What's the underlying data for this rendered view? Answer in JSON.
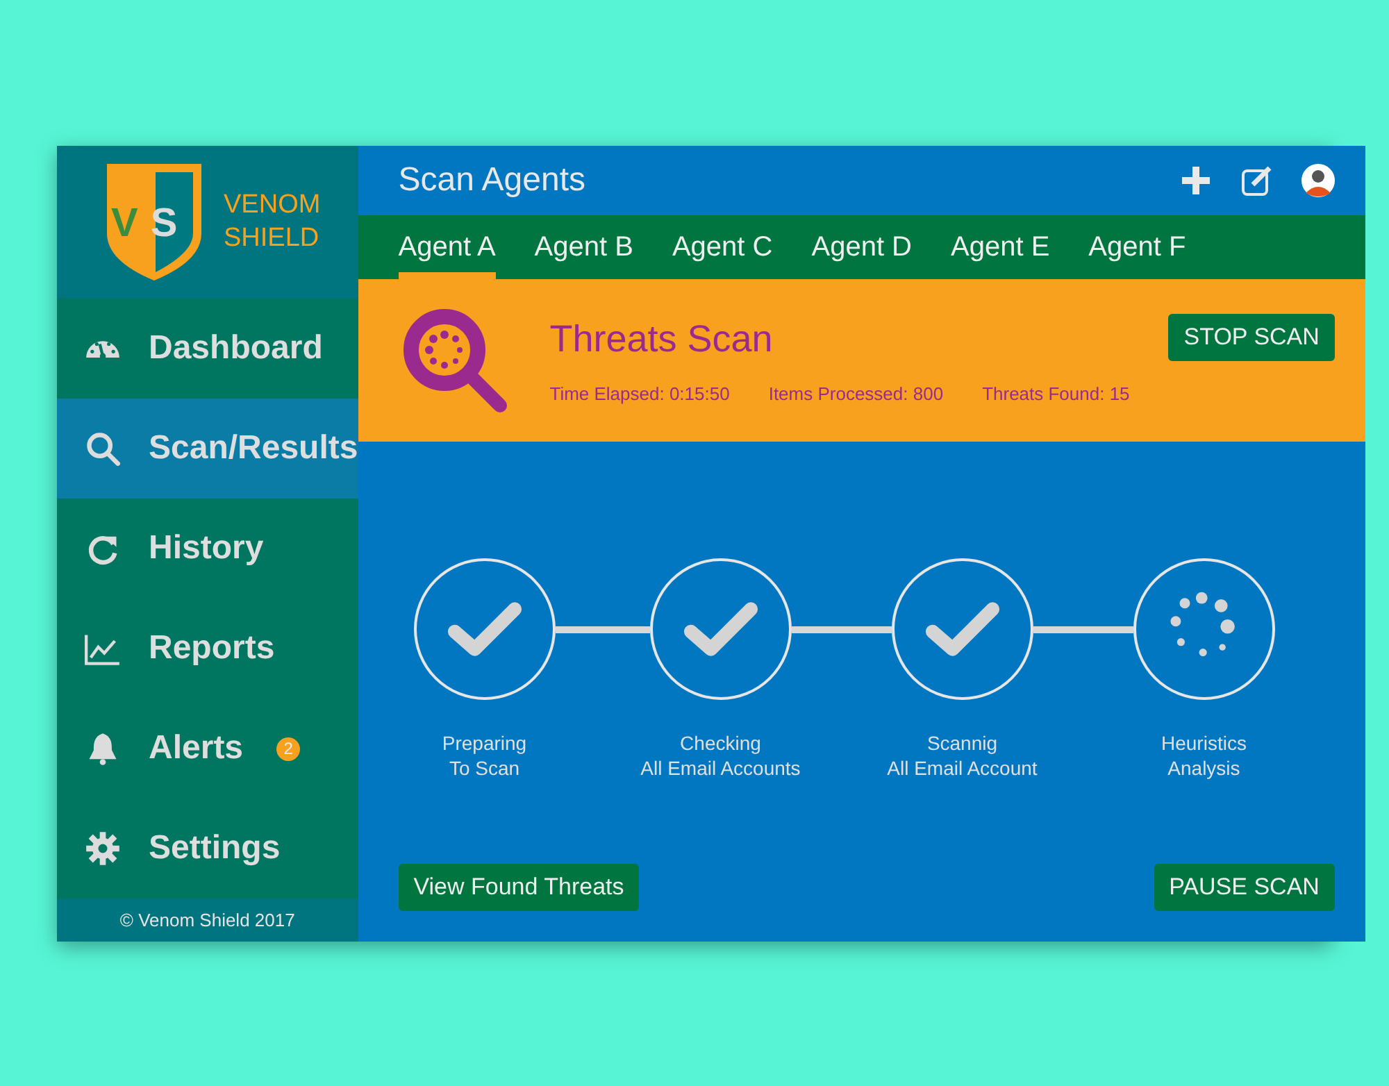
{
  "brand": {
    "line_1": "VENOM",
    "line_2": "SHIELD",
    "logo_letters": [
      "V",
      "S"
    ]
  },
  "sidebar": {
    "items": [
      {
        "label": "Dashboard",
        "selected": false
      },
      {
        "label": "Scan/Results",
        "selected": true
      },
      {
        "label": "History",
        "selected": false
      },
      {
        "label": "Reports",
        "selected": false
      },
      {
        "label": "Alerts",
        "selected": false,
        "badge": "2"
      },
      {
        "label": "Settings",
        "selected": false
      }
    ],
    "footer": "© Venom Shield 2017"
  },
  "header": {
    "title": "Scan Agents"
  },
  "tabs": [
    {
      "label": "Agent A",
      "selected": true
    },
    {
      "label": "Agent B",
      "selected": false
    },
    {
      "label": "Agent C",
      "selected": false
    },
    {
      "label": "Agent D",
      "selected": false
    },
    {
      "label": "Agent E",
      "selected": false
    },
    {
      "label": "Agent F",
      "selected": false
    }
  ],
  "scan": {
    "title": "Threats Scan",
    "stats": [
      "Time Elapsed: 0:15:50",
      "Items Processed: 800",
      "Threats Found: 15"
    ],
    "stop_button": "STOP SCAN"
  },
  "steps": [
    {
      "label": "Preparing\nTo Scan",
      "kind": "done"
    },
    {
      "label": "Checking\nAll Email Accounts",
      "kind": "done"
    },
    {
      "label": "Scannig\nAll Email Account",
      "kind": "done"
    },
    {
      "label": "Heuristics\nAnalysis",
      "kind": "running"
    }
  ],
  "buttons": {
    "view": "View Found Threats",
    "pause": "PAUSE SCAN"
  }
}
